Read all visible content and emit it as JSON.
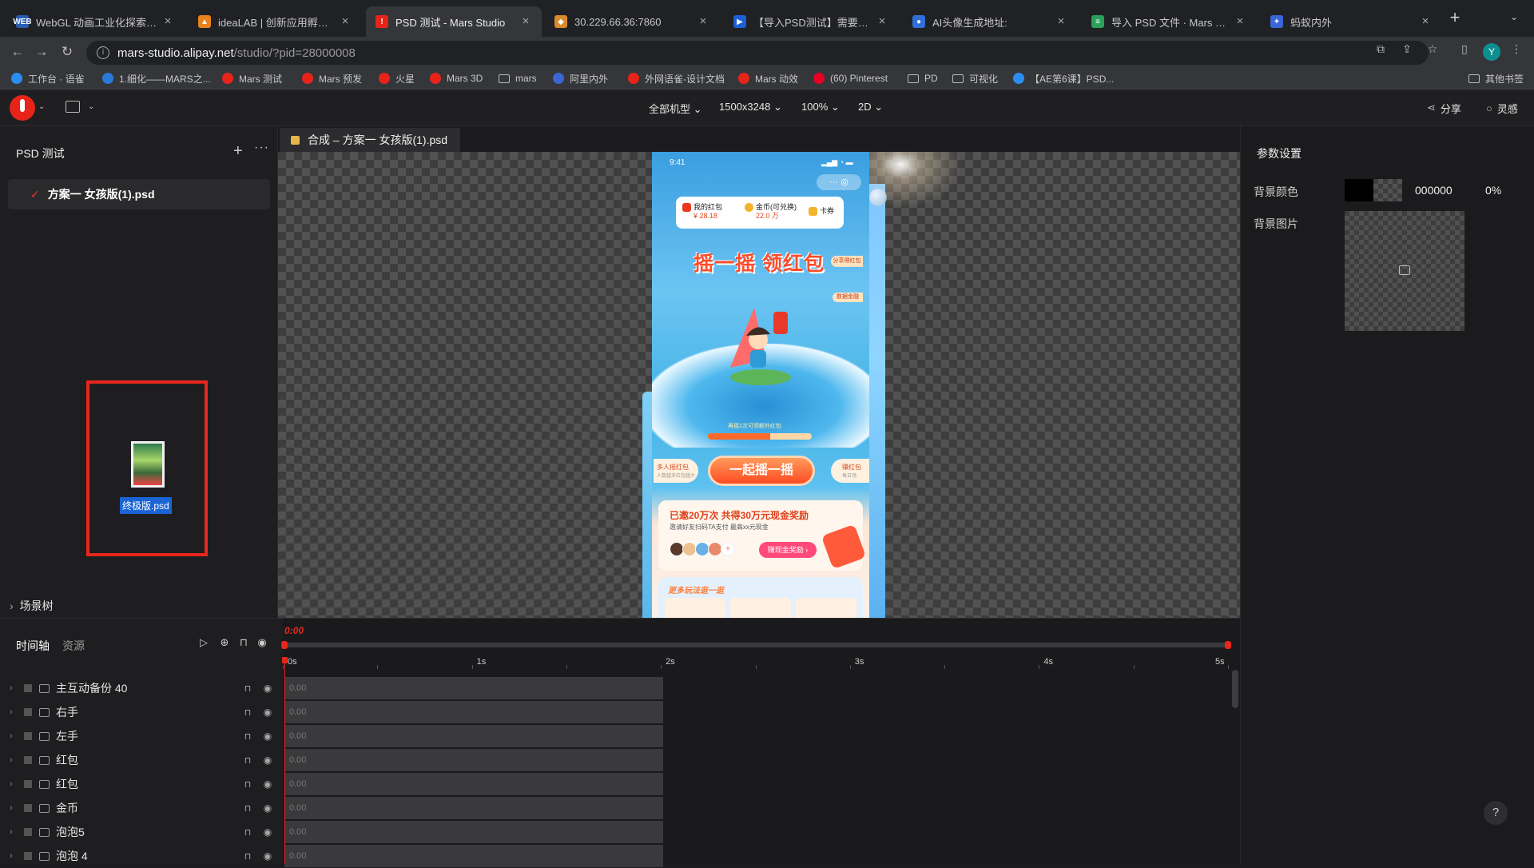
{
  "browser": {
    "tabs": [
      {
        "title": "WebGL 动画工业化探索与实践",
        "favicon_color": "#2a5db0",
        "favicon_text": "WEB"
      },
      {
        "title": "ideaLAB | 创新应用孵化平台",
        "favicon_color": "#e8821c",
        "favicon_text": "▲"
      },
      {
        "title": "PSD 测试 - Mars Studio",
        "favicon_color": "#e6241a",
        "favicon_text": "!"
      },
      {
        "title": "30.229.66.36:7860",
        "favicon_color": "#d98a2a",
        "favicon_text": "◆"
      },
      {
        "title": "【导入PSD测试】需要对PSD...",
        "favicon_color": "#1c5fd6",
        "favicon_text": "▶"
      },
      {
        "title": "AI头像生成地址:",
        "favicon_color": "#2e6fd8",
        "favicon_text": "●"
      },
      {
        "title": "导入 PSD 文件 · Mars 动效",
        "favicon_color": "#2aa05a",
        "favicon_text": "≡"
      },
      {
        "title": "蚂蚁内外",
        "favicon_color": "#3a66d6",
        "favicon_text": "✦"
      }
    ],
    "url_host": "mars-studio.alipay.net",
    "url_path": "/studio/?pid=28000008",
    "profile_initial": "Y",
    "bookmarks": [
      {
        "label": "工作台 · 语雀",
        "color": "#2a8ef0",
        "folder": false
      },
      {
        "label": "1.细化——MARS之...",
        "color": "#2a7ad8",
        "folder": false
      },
      {
        "label": "Mars 测试",
        "color": "#e6241a",
        "folder": false
      },
      {
        "label": "Mars 预发",
        "color": "#e6241a",
        "folder": false
      },
      {
        "label": "火星",
        "color": "#e6241a",
        "folder": false
      },
      {
        "label": "Mars 3D",
        "color": "#e6241a",
        "folder": false
      },
      {
        "label": "mars",
        "color": "#bbbbbb",
        "folder": true
      },
      {
        "label": "阿里内外",
        "color": "#3a66d6",
        "folder": false
      },
      {
        "label": "外网语雀-设计文档",
        "color": "#e6241a",
        "folder": false
      },
      {
        "label": "Mars 动效",
        "color": "#e6241a",
        "folder": false
      },
      {
        "label": "(60) Pinterest",
        "color": "#e60023",
        "folder": false
      },
      {
        "label": "PD",
        "color": "#bbbbbb",
        "folder": true
      },
      {
        "label": "可视化",
        "color": "#bbbbbb",
        "folder": true
      },
      {
        "label": "【AE第6课】PSD...",
        "color": "#2a8ef0",
        "folder": false
      }
    ],
    "other_bookmarks": "其他书签"
  },
  "header": {
    "device": "全部机型",
    "resolution": "1500x3248",
    "zoom": "100%",
    "mode": "2D",
    "share": "分享",
    "inspiration": "灵感"
  },
  "left_panel": {
    "project_title": "PSD 测试",
    "files": [
      {
        "name": "方案一 女孩版(1).psd"
      }
    ],
    "dragging_file": "终极版.psd",
    "scene_tree": "场景树"
  },
  "canvas": {
    "tab_label": "合成 – 方案一 女孩版(1).psd",
    "phone": {
      "time": "9:41",
      "wallet": [
        {
          "label": "我的红包",
          "value": "¥ 28.18",
          "color": "#e8391e"
        },
        {
          "label": "金币(可兑换)",
          "value": "22.0 万",
          "color": "#f2b52a"
        },
        {
          "label": "卡券",
          "value": "",
          "color": "#f2b52a"
        }
      ],
      "title": "摇一摇 领红包",
      "rules_tag": "分享得红包",
      "data_tag": "数据金融",
      "progress_label": "再摇1次可领额外红包",
      "progress": 0.6,
      "shake_button": "一起摇一摇",
      "multi_button": "多人摇红包",
      "multi_sub": "人数越多红包越大",
      "zero_button": "赚红包",
      "zero_sub": "每日领",
      "invite_title": "已邀20万次 共得30万元现金奖励",
      "invite_sub": "邀请好友扫码TA支付 最高xx元现金",
      "earn_button": "赚现金奖励 ›",
      "more_title": "更多玩法逛一逛"
    }
  },
  "right_panel": {
    "title": "参数设置",
    "bg_color_label": "背景颜色",
    "bg_color_hex": "000000",
    "bg_color_alpha": "0%",
    "bg_image_label": "背景图片"
  },
  "timeline": {
    "tab_timeline": "时间轴",
    "tab_assets": "资源",
    "current_time": "0:00",
    "ticks": [
      "0s",
      "1s",
      "2s",
      "3s",
      "4s",
      "5s"
    ],
    "layers": [
      {
        "name": "主互动备份 40",
        "start": "0.00"
      },
      {
        "name": "右手",
        "start": "0.00"
      },
      {
        "name": "左手",
        "start": "0.00"
      },
      {
        "name": "红包",
        "start": "0.00"
      },
      {
        "name": "红包",
        "start": "0.00"
      },
      {
        "name": "金币",
        "start": "0.00"
      },
      {
        "name": "泡泡5",
        "start": "0.00"
      },
      {
        "name": "泡泡 4",
        "start": "0.00"
      }
    ]
  }
}
